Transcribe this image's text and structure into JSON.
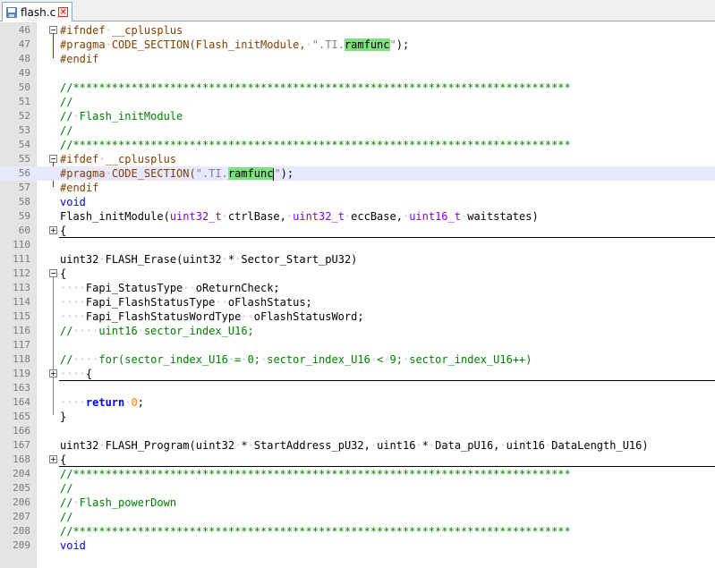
{
  "tab": {
    "file_name": "flash.c",
    "icon": "save-icon",
    "close_icon": "close-icon"
  },
  "colors": {
    "keyword": "#0000ff",
    "preprocessor": "#804000",
    "comment": "#008000",
    "number": "#ff8000",
    "type": "#8000ff",
    "highlight": "#7fe07f",
    "current_line": "#e8e8ff",
    "gutter": "#e4e4e4"
  },
  "lines": [
    {
      "n": "46",
      "fold": "minus",
      "seg": [
        [
          "pp",
          "#ifndef"
        ],
        [
          "ws",
          "·"
        ],
        [
          "pp",
          "__cplusplus"
        ]
      ]
    },
    {
      "n": "47",
      "seg": [
        [
          "pp",
          "#pragma"
        ],
        [
          "ws",
          "·"
        ],
        [
          "pp",
          "CODE_SECTION(Flash_initModule,"
        ],
        [
          "ws",
          "·"
        ],
        [
          "str",
          "\".TI."
        ],
        [
          "hl",
          "ramfunc"
        ],
        [
          "str",
          "\""
        ],
        [
          "",
          "); "
        ]
      ]
    },
    {
      "n": "48",
      "seg": [
        [
          "pp",
          "#endif"
        ]
      ]
    },
    {
      "n": "49",
      "seg": []
    },
    {
      "n": "50",
      "seg": [
        [
          "cm",
          "//*****************************************************************************"
        ]
      ]
    },
    {
      "n": "51",
      "seg": [
        [
          "cm",
          "//"
        ]
      ]
    },
    {
      "n": "52",
      "seg": [
        [
          "cm",
          "//"
        ],
        [
          "ws",
          "·"
        ],
        [
          "cm",
          "Flash_initModule"
        ]
      ]
    },
    {
      "n": "53",
      "seg": [
        [
          "cm",
          "//"
        ]
      ]
    },
    {
      "n": "54",
      "seg": [
        [
          "cm",
          "//*****************************************************************************"
        ]
      ]
    },
    {
      "n": "55",
      "fold": "minus",
      "seg": [
        [
          "pp",
          "#ifdef"
        ],
        [
          "ws",
          "·"
        ],
        [
          "pp",
          "__cplusplus"
        ]
      ]
    },
    {
      "n": "56",
      "current": true,
      "seg": [
        [
          "pp",
          "#pragma"
        ],
        [
          "ws",
          "·"
        ],
        [
          "pp",
          "CODE_SECTION("
        ],
        [
          "str",
          "\".TI."
        ],
        [
          "hl",
          "ramfunc"
        ],
        [
          "caret",
          ""
        ],
        [
          "str",
          "\""
        ],
        [
          "",
          ");"
        ]
      ]
    },
    {
      "n": "57",
      "seg": [
        [
          "pp",
          "#endif"
        ]
      ]
    },
    {
      "n": "58",
      "seg": [
        [
          "kw",
          "void"
        ]
      ]
    },
    {
      "n": "59",
      "seg": [
        [
          "",
          "Flash_initModule("
        ],
        [
          "type",
          "uint32_t"
        ],
        [
          "ws",
          "·"
        ],
        [
          "",
          "ctrlBase,"
        ],
        [
          "ws",
          "·"
        ],
        [
          "type",
          "uint32_t"
        ],
        [
          "ws",
          "·"
        ],
        [
          "",
          "eccBase,"
        ],
        [
          "ws",
          "·"
        ],
        [
          "type",
          "uint16_t"
        ],
        [
          "ws",
          "·"
        ],
        [
          "",
          "waitstates)"
        ]
      ]
    },
    {
      "n": "60",
      "fold": "plus",
      "collapsed": true,
      "seg": [
        [
          "",
          "{"
        ]
      ]
    },
    {
      "n": "110",
      "seg": []
    },
    {
      "n": "111",
      "seg": [
        [
          "",
          "uint32"
        ],
        [
          "ws",
          "·"
        ],
        [
          "",
          "FLASH_Erase(uint32"
        ],
        [
          "ws",
          "·"
        ],
        [
          "",
          "*"
        ],
        [
          "ws",
          "·"
        ],
        [
          "",
          "Sector_Start_pU32)"
        ]
      ]
    },
    {
      "n": "112",
      "fold": "minus",
      "seg": [
        [
          "",
          "{"
        ]
      ]
    },
    {
      "n": "113",
      "seg": [
        [
          "ws",
          "····"
        ],
        [
          "",
          "Fapi_StatusType"
        ],
        [
          "ws",
          "··"
        ],
        [
          "",
          "oReturnCheck;"
        ]
      ]
    },
    {
      "n": "114",
      "seg": [
        [
          "ws",
          "····"
        ],
        [
          "",
          "Fapi_FlashStatusType"
        ],
        [
          "ws",
          "··"
        ],
        [
          "",
          "oFlashStatus;"
        ]
      ]
    },
    {
      "n": "115",
      "seg": [
        [
          "ws",
          "····"
        ],
        [
          "",
          "Fapi_FlashStatusWordType"
        ],
        [
          "ws",
          "··"
        ],
        [
          "",
          "oFlashStatusWord;"
        ]
      ]
    },
    {
      "n": "116",
      "seg": [
        [
          "cm",
          "//"
        ],
        [
          "ws",
          "····"
        ],
        [
          "cm",
          "uint16"
        ],
        [
          "ws",
          "·"
        ],
        [
          "cm",
          "sector_index_U16;"
        ]
      ]
    },
    {
      "n": "117",
      "seg": []
    },
    {
      "n": "118",
      "seg": [
        [
          "cm",
          "//"
        ],
        [
          "ws",
          "····"
        ],
        [
          "cm",
          "for(sector_index_U16"
        ],
        [
          "ws",
          "·"
        ],
        [
          "cm",
          "="
        ],
        [
          "ws",
          "·"
        ],
        [
          "cm",
          "0;"
        ],
        [
          "ws",
          "·"
        ],
        [
          "cm",
          "sector_index_U16"
        ],
        [
          "ws",
          "·"
        ],
        [
          "cm",
          "<"
        ],
        [
          "ws",
          "·"
        ],
        [
          "cm",
          "9;"
        ],
        [
          "ws",
          "·"
        ],
        [
          "cm",
          "sector_index_U16++)"
        ]
      ]
    },
    {
      "n": "119",
      "fold": "plus",
      "collapsed": true,
      "seg": [
        [
          "ws",
          "····"
        ],
        [
          "",
          "{"
        ]
      ]
    },
    {
      "n": "163",
      "seg": []
    },
    {
      "n": "164",
      "seg": [
        [
          "ws",
          "····"
        ],
        [
          "kw-b",
          "return"
        ],
        [
          "ws",
          "·"
        ],
        [
          "num-lit",
          "0"
        ],
        [
          "",
          ";"
        ]
      ]
    },
    {
      "n": "165",
      "seg": [
        [
          "",
          "}"
        ]
      ]
    },
    {
      "n": "166",
      "seg": []
    },
    {
      "n": "167",
      "seg": [
        [
          "",
          "uint32"
        ],
        [
          "ws",
          "·"
        ],
        [
          "",
          "FLASH_Program(uint32"
        ],
        [
          "ws",
          "·"
        ],
        [
          "",
          "*"
        ],
        [
          "ws",
          "·"
        ],
        [
          "",
          "StartAddress_pU32,"
        ],
        [
          "ws",
          "·"
        ],
        [
          "",
          "uint16"
        ],
        [
          "ws",
          "·"
        ],
        [
          "",
          "*"
        ],
        [
          "ws",
          "·"
        ],
        [
          "",
          "Data_pU16,"
        ],
        [
          "ws",
          "·"
        ],
        [
          "",
          "uint16"
        ],
        [
          "ws",
          "·"
        ],
        [
          "",
          "DataLength_U16)"
        ]
      ]
    },
    {
      "n": "168",
      "fold": "plus",
      "collapsed": true,
      "seg": [
        [
          "",
          "{"
        ]
      ]
    },
    {
      "n": "204",
      "seg": [
        [
          "cm",
          "//*****************************************************************************"
        ]
      ]
    },
    {
      "n": "205",
      "seg": [
        [
          "cm",
          "//"
        ]
      ]
    },
    {
      "n": "206",
      "seg": [
        [
          "cm",
          "//"
        ],
        [
          "ws",
          "·"
        ],
        [
          "cm",
          "Flash_powerDown"
        ]
      ]
    },
    {
      "n": "207",
      "seg": [
        [
          "cm",
          "//"
        ]
      ]
    },
    {
      "n": "208",
      "seg": [
        [
          "cm",
          "//*****************************************************************************"
        ]
      ]
    },
    {
      "n": "209",
      "seg": [
        [
          "kw",
          "void"
        ]
      ]
    }
  ]
}
